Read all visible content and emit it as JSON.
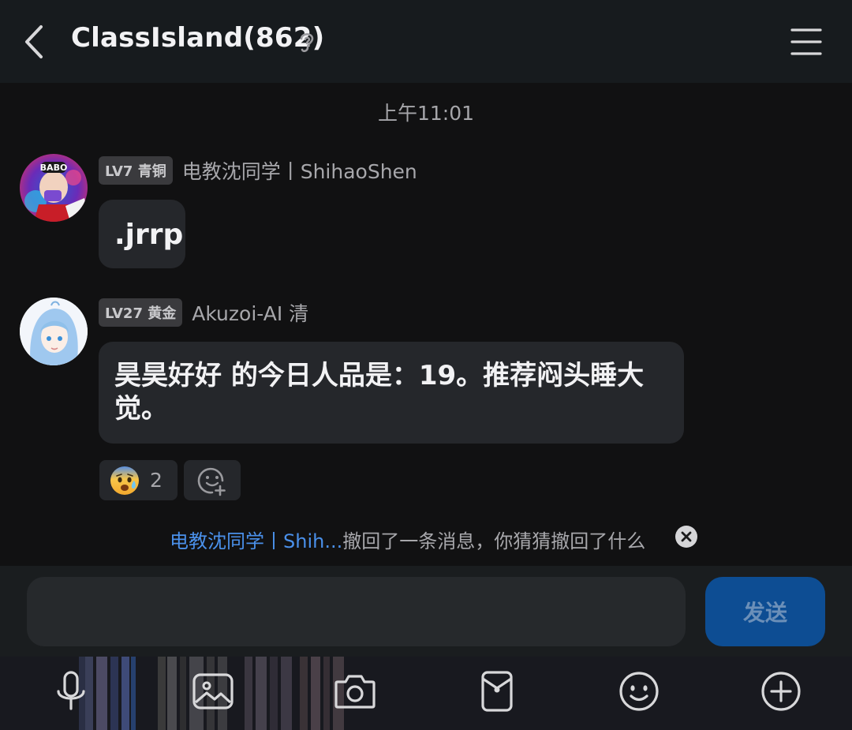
{
  "header": {
    "title": "ClassIsland(862)"
  },
  "timestamp": "上午11:01",
  "messages": [
    {
      "level": "LV7 青铜",
      "sender": "电教沈同学丨ShihaoShen",
      "text": ".jrrp"
    },
    {
      "level": "LV27 黄金",
      "sender": "Akuzoi-AI 清",
      "text": "昊昊好好 的今日人品是：19。推荐闷头睡大觉。",
      "reaction_count": "2"
    }
  ],
  "avatar_1_text": "BABO",
  "recall": {
    "who": "电教沈同学丨Shih...",
    "text": "撤回了一条消息，你猜猜撤回了什么"
  },
  "input": {
    "value": "",
    "send_label": "发送"
  },
  "colors": {
    "accent_blue": "#4a90ea",
    "send_button": "#0d4d93",
    "bubble": "#25272b",
    "background": "#111112"
  },
  "toolbar_icons": [
    "mic-icon",
    "image-icon",
    "camera-icon",
    "red-packet-icon",
    "emoji-icon",
    "plus-icon"
  ]
}
